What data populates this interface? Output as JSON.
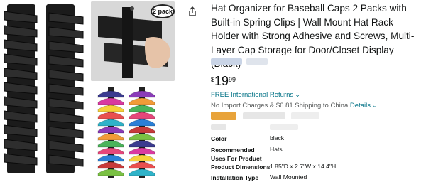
{
  "gallery": {
    "badge_label": "2 pack",
    "cap_colors": [
      "#3b3b8f",
      "#d93aa0",
      "#f7d13a",
      "#e94f4f",
      "#2fb3c9",
      "#8a3bb8",
      "#f29b38",
      "#4bb35b",
      "#e5477a",
      "#2b7fd6",
      "#c73a3a",
      "#7ac143"
    ]
  },
  "product": {
    "title": "Hat Organizer for Baseball Caps 2 Packs with Built-in Spring Clips | Wall Mount Hat Rack Holder with Strong Adhesive and Screws, Multi-Layer Cap Storage for Door/Closet Display (Black)",
    "price_symbol": "$",
    "price_whole": "19",
    "price_fraction": "99",
    "returns_label": "FREE International Returns",
    "shipping_text": "No Import Charges & $6.81 Shipping to China",
    "shipping_details_link": "Details"
  },
  "specs": [
    {
      "key": "Color",
      "value": "black"
    },
    {
      "key": "Recommended Uses For Product",
      "value": "Hats"
    },
    {
      "key": "Product Dimensions",
      "value": "1.85\"D x 2.7\"W x 14.4\"H"
    },
    {
      "key": "Installation Type",
      "value": "Wall Mounted"
    }
  ],
  "colors": {
    "link": "#007185",
    "text": "#0f1111",
    "muted": "#565959",
    "badge_blur": "#e8a33a"
  }
}
